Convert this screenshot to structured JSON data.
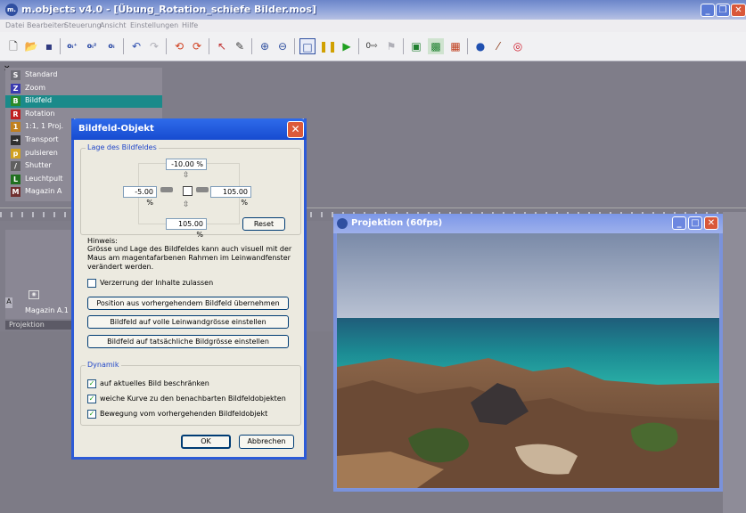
{
  "window": {
    "title": "m.objects v4.0 - [Übung_Rotation_schiefe Bilder.mos]",
    "logo_text": "m."
  },
  "menu": [
    "Datei",
    "Bearbeiten",
    "Steuerung",
    "Ansicht",
    "Einstellungen",
    "Hilfe"
  ],
  "toolbar_icons": [
    "new-file-icon",
    "open-folder-icon",
    "save-icon",
    "obj-add-icon",
    "obj-add2-icon",
    "obj-remove-icon",
    "undo-icon",
    "redo-icon",
    "rotate-left-icon",
    "rotate-right-icon",
    "pointer-icon",
    "pencil-icon",
    "zoom-in-icon",
    "zoom-out-icon",
    "frame-icon",
    "pause-icon",
    "play-icon",
    "counter-icon",
    "flag-icon",
    "image-icon",
    "image2-icon",
    "image3-icon",
    "speaker-icon",
    "wand-icon",
    "record-icon"
  ],
  "objects": [
    {
      "label": "Standard",
      "icon": "S",
      "color": "#6f6f78"
    },
    {
      "label": "Zoom",
      "icon": "Z",
      "color": "#3b3bb0"
    },
    {
      "label": "Bildfeld",
      "icon": "B",
      "color": "#2a8a2a",
      "selected": true
    },
    {
      "label": "Rotation",
      "icon": "R",
      "color": "#c02020"
    },
    {
      "label": "1:1, 1 Proj.",
      "icon": "1",
      "color": "#c08020"
    },
    {
      "label": "Transport",
      "icon": "→",
      "color": "#303030"
    },
    {
      "label": "pulsieren",
      "icon": "p",
      "color": "#d0a020"
    },
    {
      "label": "Shutter",
      "icon": "/",
      "color": "#606060"
    },
    {
      "label": "Leuchtpult",
      "icon": "L",
      "color": "#207020"
    },
    {
      "label": "Magazin A",
      "icon": "M",
      "color": "#703030"
    }
  ],
  "track": {
    "magazine_label": "Magazin A.1",
    "letter": "A",
    "lower_label": "Projektion"
  },
  "dialog": {
    "title": "Bildfeld-Objekt",
    "group_lage": "Lage des Bildfeldes",
    "top_value": "-10.00 %",
    "left_value": "-5.00 %",
    "right_value": "105.00 %",
    "bottom_value": "105.00 %",
    "reset": "Reset",
    "hint_title": "Hinweis:",
    "hint_text": "Grösse und Lage des Bildfeldes kann auch visuell mit der Maus am magentafarbenen Rahmen im Leinwandfenster verändert werden.",
    "verzerrung": "Verzerrung der Inhalte zulassen",
    "btn_position": "Position aus vorhergehendem Bildfeld übernehmen",
    "btn_volle": "Bildfeld auf volle Leinwandgrösse einstellen",
    "btn_tatsaechlich": "Bildfeld auf tatsächliche Bildgrösse einstellen",
    "group_dynamik": "Dynamik",
    "dyn1": "auf aktuelles Bild beschränken",
    "dyn2": "weiche Kurve zu den benachbarten Bildfeldobjekten",
    "dyn3": "Bewegung vom vorhergehenden Bildfeldobjekt",
    "ok": "OK",
    "cancel": "Abbrechen"
  },
  "projection": {
    "title": "Projektion (60fps)"
  }
}
